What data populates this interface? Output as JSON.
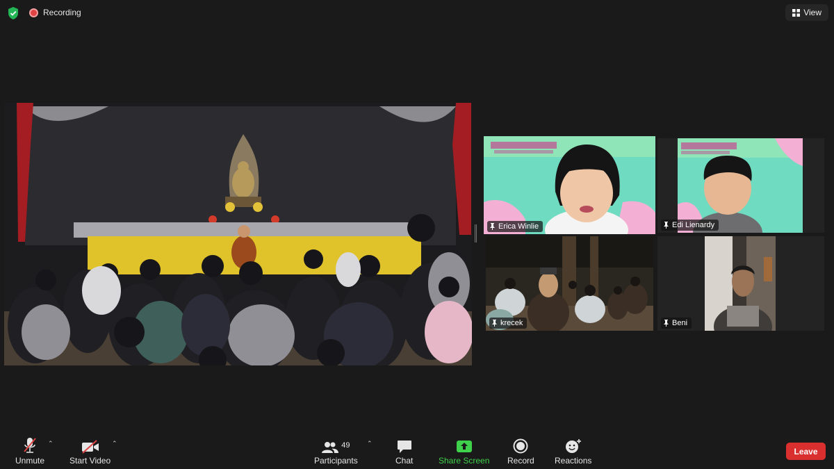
{
  "window": {
    "recording_label": "Recording",
    "view_label": "View"
  },
  "participants": [
    {
      "name": "Erica Winlie",
      "pinned": true,
      "active_speaker": true
    },
    {
      "name": "Edi Lienardy",
      "pinned": true,
      "active_speaker": false
    },
    {
      "name": "krecek",
      "pinned": true,
      "active_speaker": false
    },
    {
      "name": "Beni",
      "pinned": true,
      "active_speaker": false
    }
  ],
  "toolbar": {
    "unmute_label": "Unmute",
    "start_video_label": "Start Video",
    "participants_label": "Participants",
    "participants_count": "49",
    "chat_label": "Chat",
    "share_screen_label": "Share Screen",
    "record_label": "Record",
    "reactions_label": "Reactions",
    "leave_label": "Leave"
  },
  "colors": {
    "background": "#1a1a1a",
    "active_speaker_border": "#c9e04a",
    "share_screen_green": "#3fd14b",
    "leave_red": "#d9302f",
    "recording_red": "#e04343",
    "muted_red": "#e04343"
  }
}
